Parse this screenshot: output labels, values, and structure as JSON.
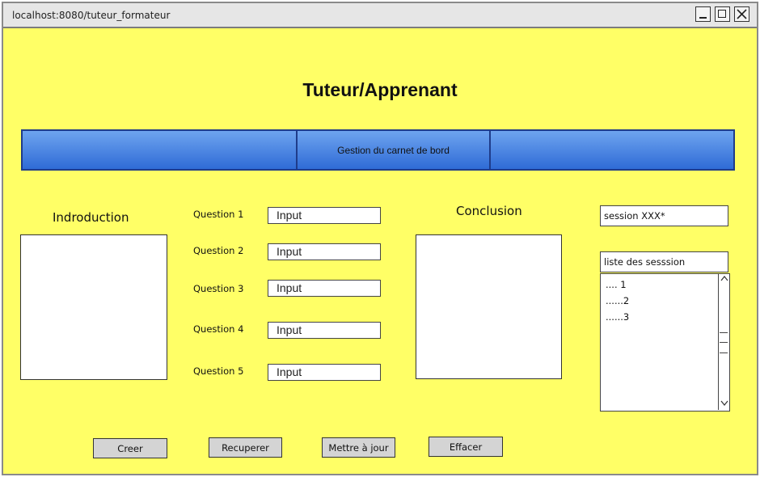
{
  "window": {
    "url": "localhost:8080/tuteur_formateur"
  },
  "page": {
    "title": "Tuteur/Apprenant"
  },
  "nav": {
    "items": [
      "",
      "Gestion du carnet de bord",
      ""
    ]
  },
  "introduction": {
    "label": "Indroduction"
  },
  "conclusion": {
    "label": "Conclusion"
  },
  "questions": [
    {
      "label": "Question 1",
      "value": "Input"
    },
    {
      "label": "Question 2",
      "value": "Input"
    },
    {
      "label": "Question 3",
      "value": "Input"
    },
    {
      "label": "Question 4",
      "value": "Input"
    },
    {
      "label": "Question 5",
      "value": "Input"
    }
  ],
  "sidebar": {
    "session_value": "session XXX*",
    "list_label": "liste des sesssion",
    "sessions": [
      ".... 1",
      "......2",
      "......3"
    ]
  },
  "actions": {
    "create": "Creer",
    "retrieve": "Recuperer",
    "update": "Mettre à jour",
    "delete": "Effacer"
  }
}
